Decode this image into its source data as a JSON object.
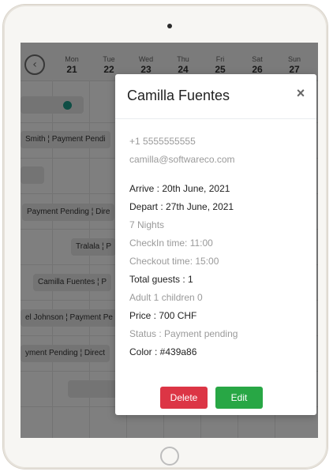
{
  "calendar": {
    "days": [
      {
        "name": "Mon",
        "date": "21"
      },
      {
        "name": "Tue",
        "date": "22"
      },
      {
        "name": "Wed",
        "date": "23"
      },
      {
        "name": "Thu",
        "date": "24"
      },
      {
        "name": "Fri",
        "date": "25"
      },
      {
        "name": "Sat",
        "date": "26"
      },
      {
        "name": "Sun",
        "date": "27"
      }
    ],
    "events": [
      "Smith ¦ Payment Pendi",
      "Payment Pending ¦ Dire",
      "Tralala ¦ P",
      "Camilla Fuentes ¦ P",
      "el Johnson ¦ Payment Pe",
      "yment Pending ¦ Direct"
    ]
  },
  "modal": {
    "title": "Camilla Fuentes",
    "close": "×",
    "phone": "+1 5555555555",
    "email": "camilla@softwareco.com",
    "arrive": "Arrive : 20th June, 2021",
    "depart": "Depart : 27th June, 2021",
    "nights": "7 Nights",
    "checkin": "CheckIn time: 11:00",
    "checkout": "Checkout time: 15:00",
    "total_guests": "Total guests : 1",
    "adults_children": "Adult 1 children 0",
    "price": "Price : 700 CHF",
    "status": "Status : Payment pending",
    "color": "Color : #439a86",
    "delete_label": "Delete",
    "edit_label": "Edit"
  },
  "colors": {
    "delete": "#dc3545",
    "edit": "#28a745",
    "teal": "#1f9c8a"
  },
  "icons": {
    "back": "chevron-left-icon",
    "close": "close-icon"
  }
}
